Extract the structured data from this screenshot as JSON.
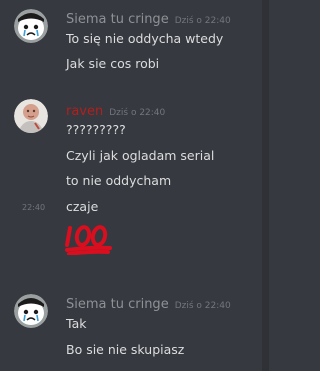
{
  "colors": {
    "background": "#36393f",
    "text": "#dcddde",
    "muted": "#72767d",
    "author_default": "#8e9297",
    "author_raven": "#b11f1f",
    "emoji_red": "#d90e1e"
  },
  "messages": [
    {
      "author": "Siema tu cringe",
      "timestamp": "Dziś o 22:40",
      "avatar_icon": "crying-face-avatar-icon",
      "lines": [
        "To się nie oddycha wtedy",
        "Jak sie cos robi"
      ]
    },
    {
      "author": "raven",
      "timestamp": "Dziś o 22:40",
      "avatar_icon": "person-photo-avatar-icon",
      "lines": [
        "?????????",
        "Czyli jak ogladam serial",
        "to nie oddycham"
      ],
      "followups": [
        {
          "side_time": "22:40",
          "text": "czaje"
        },
        {
          "emoji": "hundred-points-emoji-icon"
        }
      ]
    },
    {
      "author": "Siema tu cringe",
      "timestamp": "Dziś o 22:40",
      "avatar_icon": "crying-face-avatar-icon",
      "lines": [
        "Tak",
        "Bo sie nie skupiasz"
      ]
    }
  ]
}
